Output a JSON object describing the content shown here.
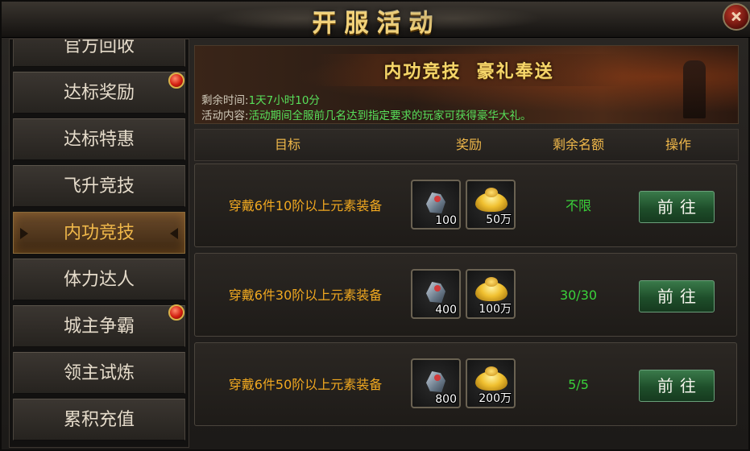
{
  "title": "开服活动",
  "sidebar": {
    "items": [
      {
        "label": "官方回收",
        "active": false,
        "badge": false
      },
      {
        "label": "达标奖励",
        "active": false,
        "badge": true
      },
      {
        "label": "达标特惠",
        "active": false,
        "badge": false
      },
      {
        "label": "飞升竞技",
        "active": false,
        "badge": false
      },
      {
        "label": "内功竞技",
        "active": true,
        "badge": false
      },
      {
        "label": "体力达人",
        "active": false,
        "badge": false
      },
      {
        "label": "城主争霸",
        "active": false,
        "badge": true
      },
      {
        "label": "领主试炼",
        "active": false,
        "badge": false
      },
      {
        "label": "累积充值",
        "active": false,
        "badge": false
      }
    ]
  },
  "banner": {
    "title": "内功竞技  豪礼奉送",
    "time_label": "剩余时间:",
    "time_value": "1天7小时10分",
    "content_label": "活动内容:",
    "content_value": "活动期间全服前几名达到指定要求的玩家可获得豪华大礼。"
  },
  "table": {
    "headers": {
      "target": "目标",
      "reward": "奖励",
      "remaining": "剩余名额",
      "action": "操作"
    },
    "rows": [
      {
        "target": "穿戴6件10阶以上元素装备",
        "reward1_icon": "ore-icon",
        "reward1_qty": "100",
        "reward2_icon": "gold-ingot-icon",
        "reward2_qty": "50万",
        "remaining": "不限",
        "action": "前往"
      },
      {
        "target": "穿戴6件30阶以上元素装备",
        "reward1_icon": "ore-icon",
        "reward1_qty": "400",
        "reward2_icon": "gold-ingot-icon",
        "reward2_qty": "100万",
        "remaining": "30/30",
        "action": "前往"
      },
      {
        "target": "穿戴6件50阶以上元素装备",
        "reward1_icon": "ore-icon",
        "reward1_qty": "800",
        "reward2_icon": "gold-ingot-icon",
        "reward2_qty": "200万",
        "remaining": "5/5",
        "action": "前往"
      }
    ]
  },
  "colors": {
    "accent_gold": "#f0b84a",
    "target_orange": "#f0a820",
    "remain_green": "#3ad23a",
    "button_green": "#2a6a3a"
  }
}
